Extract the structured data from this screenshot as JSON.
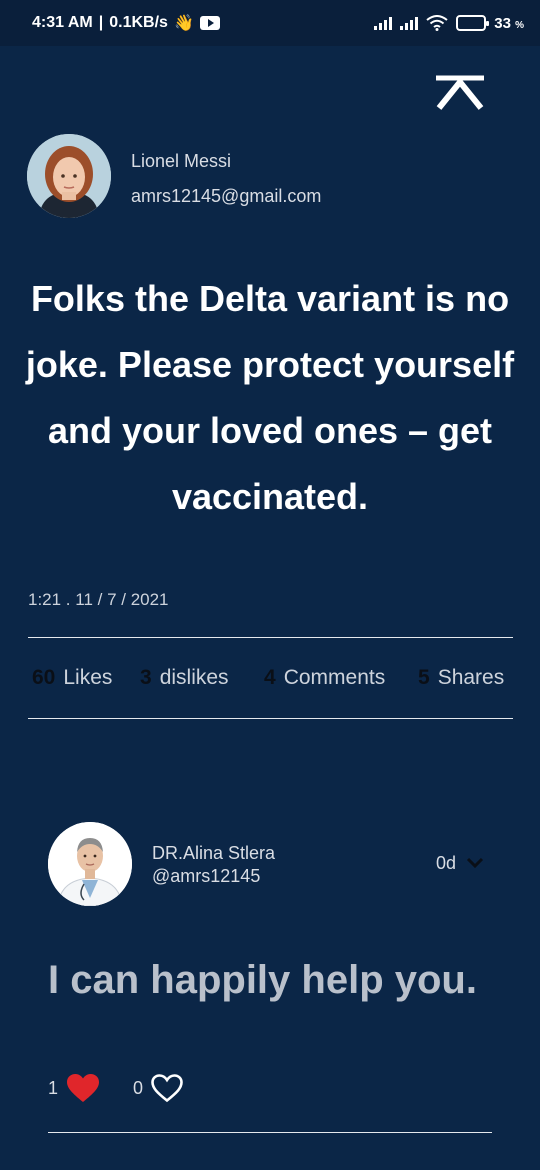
{
  "status_bar": {
    "time": "4:31 AM",
    "speed": "0.1KB/s",
    "battery_percent": "33",
    "battery_unit": "%",
    "battery_level": 0.33,
    "battery_color": "#e8b730"
  },
  "post": {
    "author_name": "Lionel Messi",
    "author_email": "amrs12145@gmail.com",
    "text": "Folks the Delta variant is no joke. Please protect yourself and your loved ones – get vaccinated.",
    "timestamp": "1:21 . 11 / 7 / 2021",
    "stats": {
      "likes_count": "60",
      "likes_label": "Likes",
      "dislikes_count": "3",
      "dislikes_label": "dislikes",
      "comments_count": "4",
      "comments_label": "Comments",
      "shares_count": "5",
      "shares_label": "Shares"
    }
  },
  "comment": {
    "author_name": "DR.Alina Stlera",
    "author_handle": "@amrs12145",
    "age": "0d",
    "text": "I can happily help you.",
    "like_count": "1",
    "dislike_count": "0"
  },
  "colors": {
    "background": "#0b2647",
    "status_bar": "#0a1f3b",
    "heart": "#e0262b"
  }
}
